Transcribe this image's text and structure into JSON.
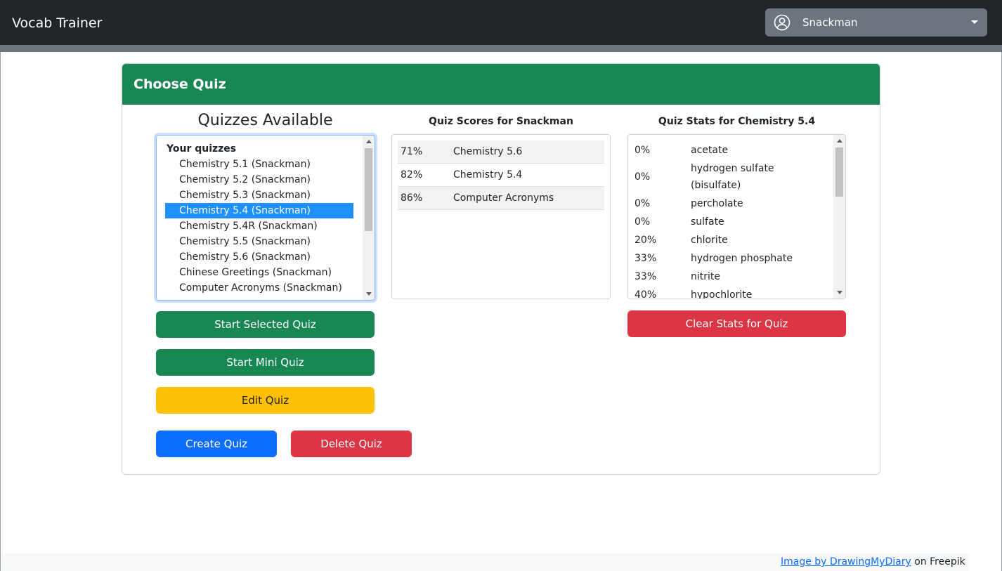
{
  "app": {
    "brand": "Vocab Trainer",
    "user_menu": {
      "username": "Snackman",
      "icon": "user-circle-icon"
    }
  },
  "card": {
    "title": "Choose Quiz"
  },
  "quizzes": {
    "title": "Quizzes Available",
    "group_label": "Your quizzes",
    "items": [
      "Chemistry 5.1 (Snackman)",
      "Chemistry 5.2 (Snackman)",
      "Chemistry 5.3 (Snackman)",
      "Chemistry 5.4 (Snackman)",
      "Chemistry 5.4R (Snackman)",
      "Chemistry 5.5 (Snackman)",
      "Chemistry 5.6 (Snackman)",
      "Chinese Greetings (Snackman)",
      "Computer Acronyms (Snackman)"
    ],
    "selected_item": "Chemistry 5.4 (Snackman)",
    "buttons": {
      "start_selected": "Start Selected Quiz",
      "start_mini": "Start Mini Quiz",
      "edit": "Edit Quiz",
      "create": "Create Quiz",
      "delete": "Delete Quiz"
    }
  },
  "scores": {
    "title": "Quiz Scores for Snackman",
    "rows": [
      {
        "pct": "71%",
        "quiz": "Chemistry 5.6"
      },
      {
        "pct": "82%",
        "quiz": "Chemistry 5.4"
      },
      {
        "pct": "86%",
        "quiz": "Computer Acronyms"
      }
    ]
  },
  "stats": {
    "title": "Quiz Stats for Chemistry 5.4",
    "rows": [
      {
        "pct": "0%",
        "term": "acetate"
      },
      {
        "pct": "0%",
        "term": "hydrogen sulfate (bisulfate)"
      },
      {
        "pct": "0%",
        "term": "percholate"
      },
      {
        "pct": "0%",
        "term": "sulfate"
      },
      {
        "pct": "20%",
        "term": "chlorite"
      },
      {
        "pct": "33%",
        "term": "hydrogen phosphate"
      },
      {
        "pct": "33%",
        "term": "nitrite"
      },
      {
        "pct": "40%",
        "term": "hypochlorite"
      }
    ],
    "clear_button": "Clear Stats for Quiz"
  },
  "footer": {
    "credit_link": "Image by DrawingMyDiary",
    "credit_suffix": " on Freepik"
  },
  "colors": {
    "navbar": "#212529",
    "success": "#198754",
    "warning": "#ffc107",
    "primary": "#0d6efd",
    "danger": "#dc3545",
    "selection": "#1e90ff"
  }
}
